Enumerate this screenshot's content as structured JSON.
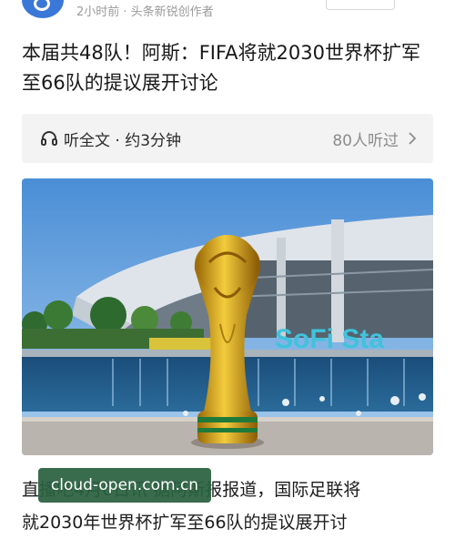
{
  "header": {
    "meta": "2小时前 · 头条新锐创作者"
  },
  "article": {
    "title": "本届共48队！阿斯：FIFA将就2030世界杯扩军至66队的提议展开讨论",
    "listen": {
      "label": "听全文 · 约3分钟",
      "count": "80人听过"
    },
    "photo": {
      "sign_text": "SoFi Sta"
    },
    "body_lines": [
      "直播吧4月6日讯 据阿斯报报道，国际足联将",
      "就2030年世界杯扩军至66队的提议展开讨"
    ]
  },
  "watermark": "cloud-open.com.cn",
  "colors": {
    "accent_blue": "#3a78d8",
    "watermark_green": "#2a6040",
    "sign_cyan": "#3fc3dc"
  }
}
